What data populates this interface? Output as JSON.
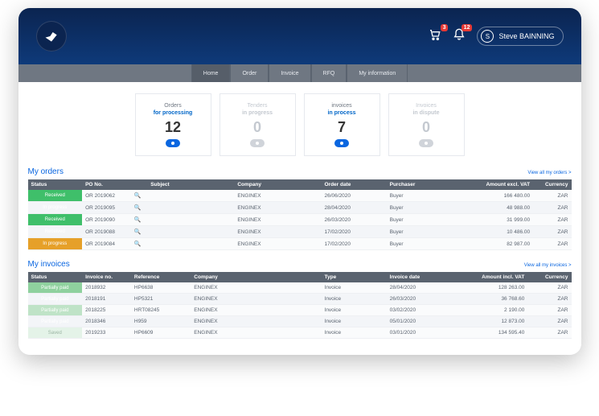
{
  "header": {
    "cart_badge": "3",
    "bell_badge": "12",
    "user_initial": "S",
    "user_name": "Steve BAINNING"
  },
  "nav": {
    "items": [
      "Home",
      "Order",
      "Invoice",
      "RFQ",
      "My information"
    ],
    "active": "Home"
  },
  "cards": [
    {
      "line1": "Orders",
      "line2": "for processing",
      "value": "12",
      "active": true
    },
    {
      "line1": "Tenders",
      "line2": "in progress",
      "value": "0",
      "active": false
    },
    {
      "line1": "invoices",
      "line2": "in process",
      "value": "7",
      "active": true
    },
    {
      "line1": "Invoices",
      "line2": "in dispute",
      "value": "0",
      "active": false
    }
  ],
  "orders": {
    "title": "My orders",
    "view_all": "View all my orders >",
    "cols": [
      "Status",
      "PO No.",
      "",
      "Subject",
      "Company",
      "Order date",
      "Purchaser",
      "Amount excl. VAT",
      "Currency"
    ],
    "rows": [
      {
        "status": "Received",
        "status_cls": "st-received",
        "po": "OR 2019062",
        "company": "ENGINEX",
        "date": "26/06/2020",
        "purchaser": "Buyer",
        "amount": "166 480.00",
        "cur": "ZAR"
      },
      {
        "status": "In progress",
        "status_cls": "st-progress",
        "po": "OR 2019095",
        "company": "ENGINEX",
        "date": "28/04/2020",
        "purchaser": "Buyer",
        "amount": "48 988.00",
        "cur": "ZAR"
      },
      {
        "status": "Received",
        "status_cls": "st-received",
        "po": "OR 2019090",
        "company": "ENGINEX",
        "date": "26/03/2020",
        "purchaser": "Buyer",
        "amount": "31 999.00",
        "cur": "ZAR"
      },
      {
        "status": "Received",
        "status_cls": "st-received",
        "po": "OR 2019088",
        "company": "ENGINEX",
        "date": "17/02/2020",
        "purchaser": "Buyer",
        "amount": "10 486.00",
        "cur": "ZAR"
      },
      {
        "status": "In progress",
        "status_cls": "st-progress",
        "po": "OR 2019084",
        "company": "ENGINEX",
        "date": "17/02/2020",
        "purchaser": "Buyer",
        "amount": "82 987.00",
        "cur": "ZAR"
      }
    ]
  },
  "invoices": {
    "title": "My invoices",
    "view_all": "View all my invoices >",
    "cols": [
      "Status",
      "Invoice no.",
      "Reference",
      "Company",
      "Type",
      "Invoice date",
      "Amount incl. VAT",
      "Currency"
    ],
    "rows": [
      {
        "status": "Partially paid",
        "status_cls": "st-partial",
        "no": "2018932",
        "ref": "HP6638",
        "company": "ENGINEX",
        "type": "Invoice",
        "date": "28/04/2020",
        "amount": "128 263.00",
        "cur": "ZAR"
      },
      {
        "status": "Partially paid",
        "status_cls": "st-partial2",
        "no": "2018191",
        "ref": "HP5321",
        "company": "ENGINEX",
        "type": "Invoice",
        "date": "26/03/2020",
        "amount": "36 768.60",
        "cur": "ZAR"
      },
      {
        "status": "Partially paid",
        "status_cls": "st-partial3",
        "no": "2018225",
        "ref": "HRT08245",
        "company": "ENGINEX",
        "type": "Invoice",
        "date": "03/02/2020",
        "amount": "2 190.00",
        "cur": "ZAR"
      },
      {
        "status": "Partially paid",
        "status_cls": "st-partial4",
        "no": "2018346",
        "ref": "H959",
        "company": "ENGINEX",
        "type": "Invoice",
        "date": "05/01/2020",
        "amount": "12 873.00",
        "cur": "ZAR"
      },
      {
        "status": "Saved",
        "status_cls": "st-saved",
        "no": "2019233",
        "ref": "HP6609",
        "company": "ENGINEX",
        "type": "Invoice",
        "date": "03/01/2020",
        "amount": "134 595.40",
        "cur": "ZAR"
      }
    ]
  }
}
